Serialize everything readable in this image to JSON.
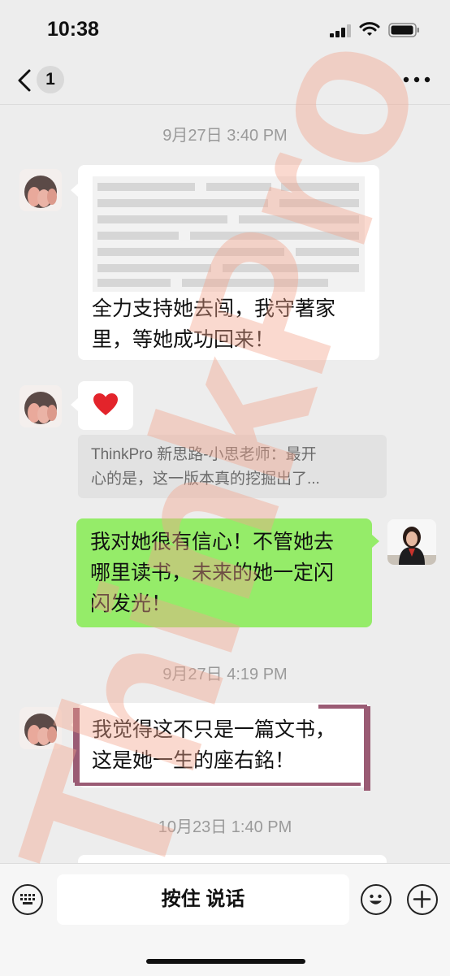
{
  "status_bar": {
    "time": "10:38"
  },
  "nav": {
    "unread_count": "1"
  },
  "messages": [
    {
      "timestamp": "9月27日 3:40 PM",
      "text": "全力支持她去闯，我守著家里，等她成功回来！",
      "line1": "全力支持她去闯，我守著家",
      "line2": "里，等她成功回来！"
    },
    {
      "emoji": "❤️",
      "quote_line1": "ThinkPro 新思路-小思老师：最开",
      "quote_line2": "心的是，这一版本真的挖掘出了..."
    },
    {
      "line1": "我对她很有信心！不管她去",
      "line2": "哪里读书，未来的她一定闪",
      "line3": "闪发光！"
    },
    {
      "timestamp": "9月27日 4:19 PM",
      "line1": "我觉得这不只是一篇文书，",
      "line2": "这是她一生的座右銘！"
    },
    {
      "timestamp": "10月23日 1:40 PM"
    }
  ],
  "input_bar": {
    "hold_to_talk": "按住 说话"
  },
  "watermark": {
    "text": "ThinkPro",
    "color": "#f2a58d"
  },
  "colors": {
    "sent_bubble": "#95ec69",
    "background": "#ededed"
  }
}
